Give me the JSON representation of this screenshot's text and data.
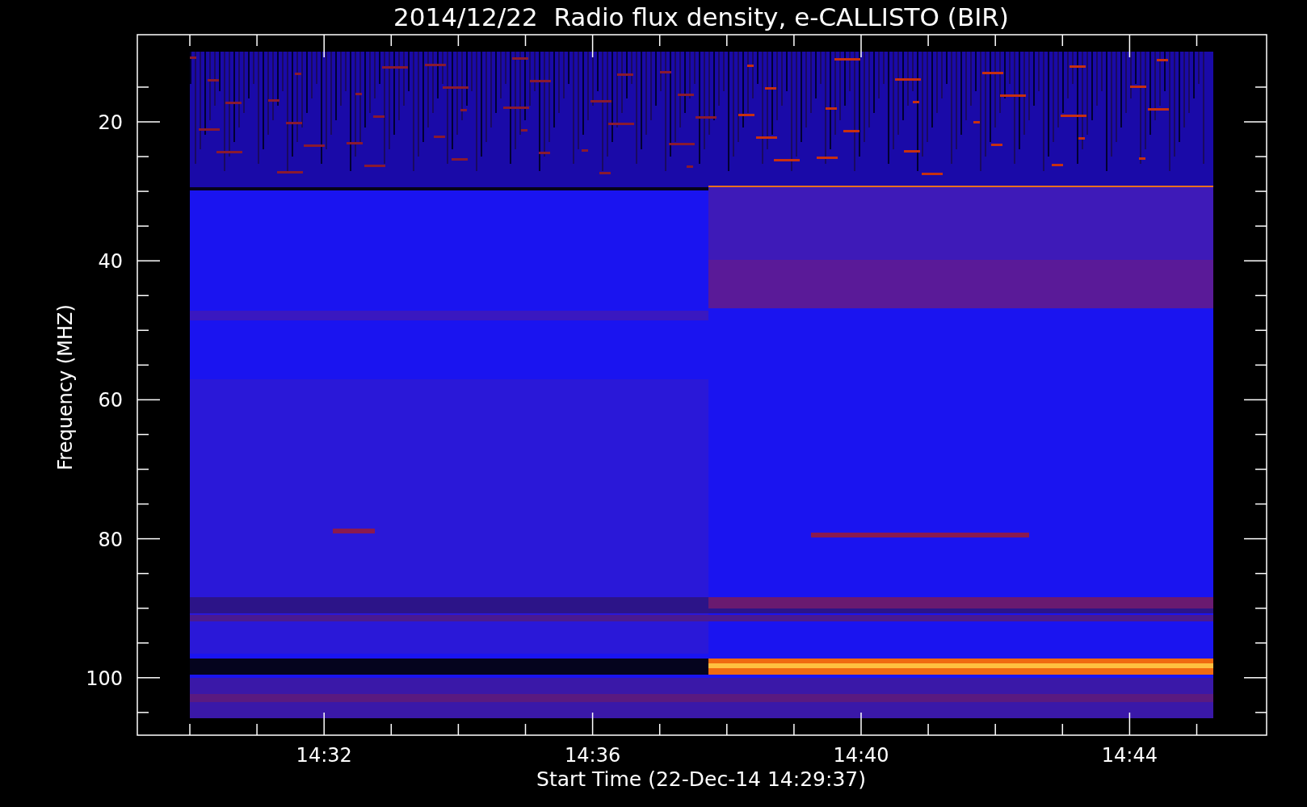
{
  "title": "2014/12/22  Radio flux density, e-CALLISTO (BIR)",
  "y_axis": {
    "label": "Frequency (MHZ)",
    "ticks": [
      "20",
      "40",
      "60",
      "80",
      "100"
    ]
  },
  "x_axis": {
    "label": "Start Time (22-Dec-14 14:29:37)",
    "ticks": [
      "14:32",
      "14:36",
      "14:40",
      "14:44"
    ]
  }
}
